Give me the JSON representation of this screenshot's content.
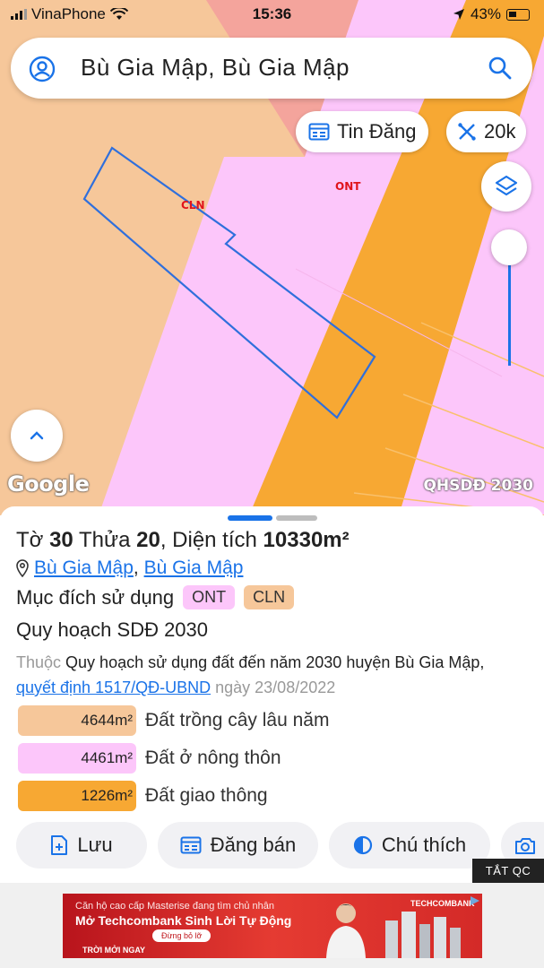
{
  "status": {
    "carrier": "VinaPhone",
    "time": "15:36",
    "battery": "43%"
  },
  "search": {
    "query": "Bù Gia Mập, Bù Gia Mập"
  },
  "map": {
    "tin_dang_label": "Tin Đăng",
    "scale_label": "20k",
    "zone_labels": {
      "cln": "CLN",
      "ont": "ONT"
    },
    "google_logo": "Google",
    "layer_name": "QHSDĐ 2030",
    "colors": {
      "cln": "#f6c79a",
      "ont": "#fcc6fa",
      "road": "#f7a833",
      "residential_pink": "#f4a49c",
      "parcel_outline": "#2f6fdc"
    }
  },
  "sheet": {
    "title": {
      "to_label": "Tờ",
      "to_value": "30",
      "thua_label": "Thửa",
      "thua_value": "20",
      "dien_tich_label": "Diện tích",
      "dien_tich_value": "10330m²"
    },
    "address": {
      "commune": "Bù Gia Mập",
      "separator": ", ",
      "district": "Bù Gia Mập"
    },
    "purpose": {
      "label": "Mục đích sử dụng",
      "codes": [
        "ONT",
        "CLN"
      ]
    },
    "plan_title": "Quy hoạch SDĐ 2030",
    "description": {
      "prefix": "Thuộc",
      "plan_name": "Quy hoạch sử dụng đất đến năm 2030 huyện Bù Gia Mập",
      "comma": ",",
      "decision": "quyết định 1517/QĐ-UBND",
      "date": "ngày 23/08/2022"
    },
    "areas": [
      {
        "value": "4644m²",
        "label": "Đất trồng cây lâu năm",
        "color": "#f6c79a"
      },
      {
        "value": "4461m²",
        "label": "Đất ở nông thôn",
        "color": "#fcc6fa"
      },
      {
        "value": "1226m²",
        "label": "Đất giao thông",
        "color": "#f7a833"
      }
    ],
    "actions": {
      "save": "Lưu",
      "post_sale": "Đăng bán",
      "legend": "Chú thích"
    }
  },
  "ad": {
    "close_label": "TẮT QC",
    "line1": "Căn hộ cao cấp Masterise đang tìm chủ nhân",
    "line2": "Mở Techcombank Sinh Lời Tự Động",
    "cta": "Đừng bỏ lỡ",
    "line3": "TRỜI MỞI NGAY",
    "brand": "TECHCOMBANK"
  }
}
